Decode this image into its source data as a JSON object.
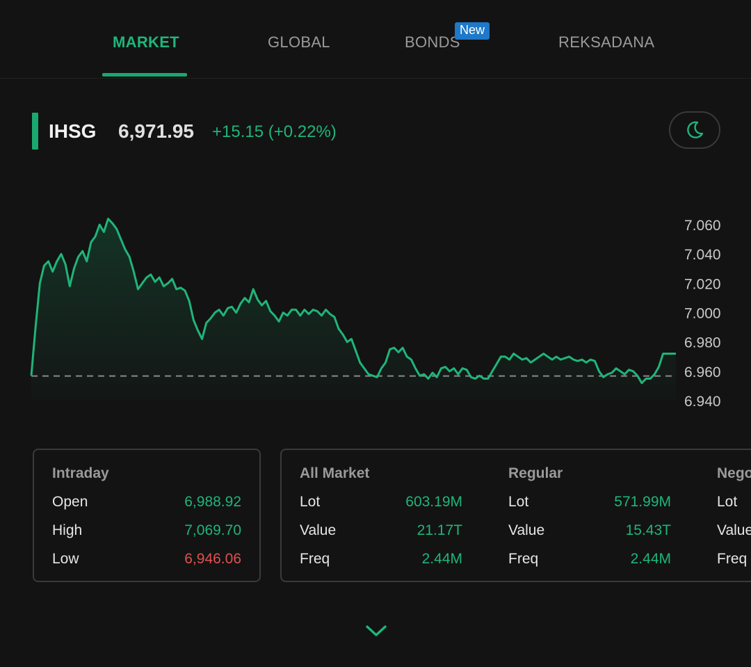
{
  "tabs": [
    {
      "label": "MARKET",
      "active": true
    },
    {
      "label": "GLOBAL",
      "active": false
    },
    {
      "label": "BONDS",
      "active": false,
      "badge": "New"
    },
    {
      "label": "REKSADANA",
      "active": false
    }
  ],
  "index": {
    "name": "IHSG",
    "price": "6,971.95",
    "change": "+15.15 (+0.22%)"
  },
  "icons": {
    "theme_toggle": "moon-icon",
    "expand": "chevron-down-icon"
  },
  "colors": {
    "accent": "#1aa86f",
    "down": "#e05050",
    "background": "#131313"
  },
  "chart_data": {
    "type": "area",
    "y_ticks": [
      "7.060",
      "7.040",
      "7.020",
      "7.000",
      "6.980",
      "6.960",
      "6.940"
    ],
    "ylim": [
      6940,
      7065
    ],
    "baseline": 6956.8,
    "series": [
      {
        "values": [
          6957,
          6990,
          7020,
          7032,
          7035,
          7028,
          7035,
          7040,
          7033,
          7018,
          7030,
          7038,
          7042,
          7035,
          7048,
          7052,
          7060,
          7055,
          7064,
          7061,
          7057,
          7050,
          7043,
          7038,
          7028,
          7016,
          7020,
          7024,
          7026,
          7021,
          7024,
          7018,
          7020,
          7023,
          7016,
          7017,
          7015,
          7008,
          6995,
          6988,
          6982,
          6993,
          6996,
          7000,
          7002,
          6998,
          7003,
          7004,
          7000,
          7006,
          7010,
          7007,
          7016,
          7009,
          7005,
          7008,
          7001,
          6998,
          6994,
          7000,
          6998,
          7002,
          7002,
          6998,
          7002,
          6999,
          7002,
          7001,
          6998,
          7002,
          6999,
          6997,
          6989,
          6985,
          6980,
          6982,
          6974,
          6966,
          6962,
          6958,
          6957,
          6956,
          6962,
          6966,
          6975,
          6976,
          6973,
          6976,
          6970,
          6968,
          6962,
          6957,
          6958,
          6955,
          6959,
          6956,
          6962,
          6963,
          6960,
          6962,
          6958,
          6962,
          6961,
          6956,
          6955,
          6957,
          6955,
          6955,
          6960,
          6965,
          6970,
          6970,
          6968,
          6972,
          6970,
          6968,
          6969,
          6966,
          6968,
          6970,
          6972,
          6970,
          6968,
          6970,
          6968,
          6969,
          6970,
          6968,
          6967,
          6968,
          6966,
          6968,
          6967,
          6960,
          6956,
          6958,
          6959,
          6962,
          6960,
          6958,
          6961,
          6960,
          6957,
          6952,
          6955,
          6955,
          6958,
          6963,
          6972,
          6972,
          6972,
          6972
        ]
      }
    ]
  },
  "intraday": {
    "title": "Intraday",
    "rows": [
      {
        "label": "Open",
        "value": "6,988.92"
      },
      {
        "label": "High",
        "value": "7,069.70"
      },
      {
        "label": "Low",
        "value": "6,946.06"
      }
    ]
  },
  "stats": [
    {
      "title": "All Market",
      "rows": [
        {
          "label": "Lot",
          "value": "603.19M"
        },
        {
          "label": "Value",
          "value": "21.17T"
        },
        {
          "label": "Freq",
          "value": "2.44M"
        }
      ]
    },
    {
      "title": "Regular",
      "rows": [
        {
          "label": "Lot",
          "value": "571.99M"
        },
        {
          "label": "Value",
          "value": "15.43T"
        },
        {
          "label": "Freq",
          "value": "2.44M"
        }
      ]
    },
    {
      "title": "Nego",
      "rows": [
        {
          "label": "Lot"
        },
        {
          "label": "Value"
        },
        {
          "label": "Freq"
        }
      ]
    }
  ]
}
